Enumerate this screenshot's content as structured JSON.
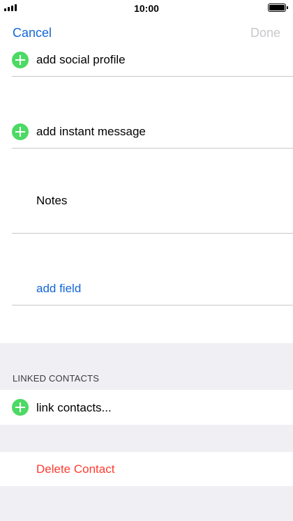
{
  "status_bar": {
    "time": "10:00"
  },
  "nav": {
    "cancel_label": "Cancel",
    "done_label": "Done"
  },
  "rows": {
    "social_profile": "add social profile",
    "instant_message": "add instant message",
    "notes_label": "Notes",
    "add_field": "add field"
  },
  "linked_contacts": {
    "header": "LINKED CONTACTS",
    "link_label": "link contacts..."
  },
  "delete_label": "Delete Contact",
  "colors": {
    "accent": "#1366d6",
    "add_green": "#4cd964",
    "destructive": "#ff3b30",
    "group_background": "#efeff4"
  }
}
